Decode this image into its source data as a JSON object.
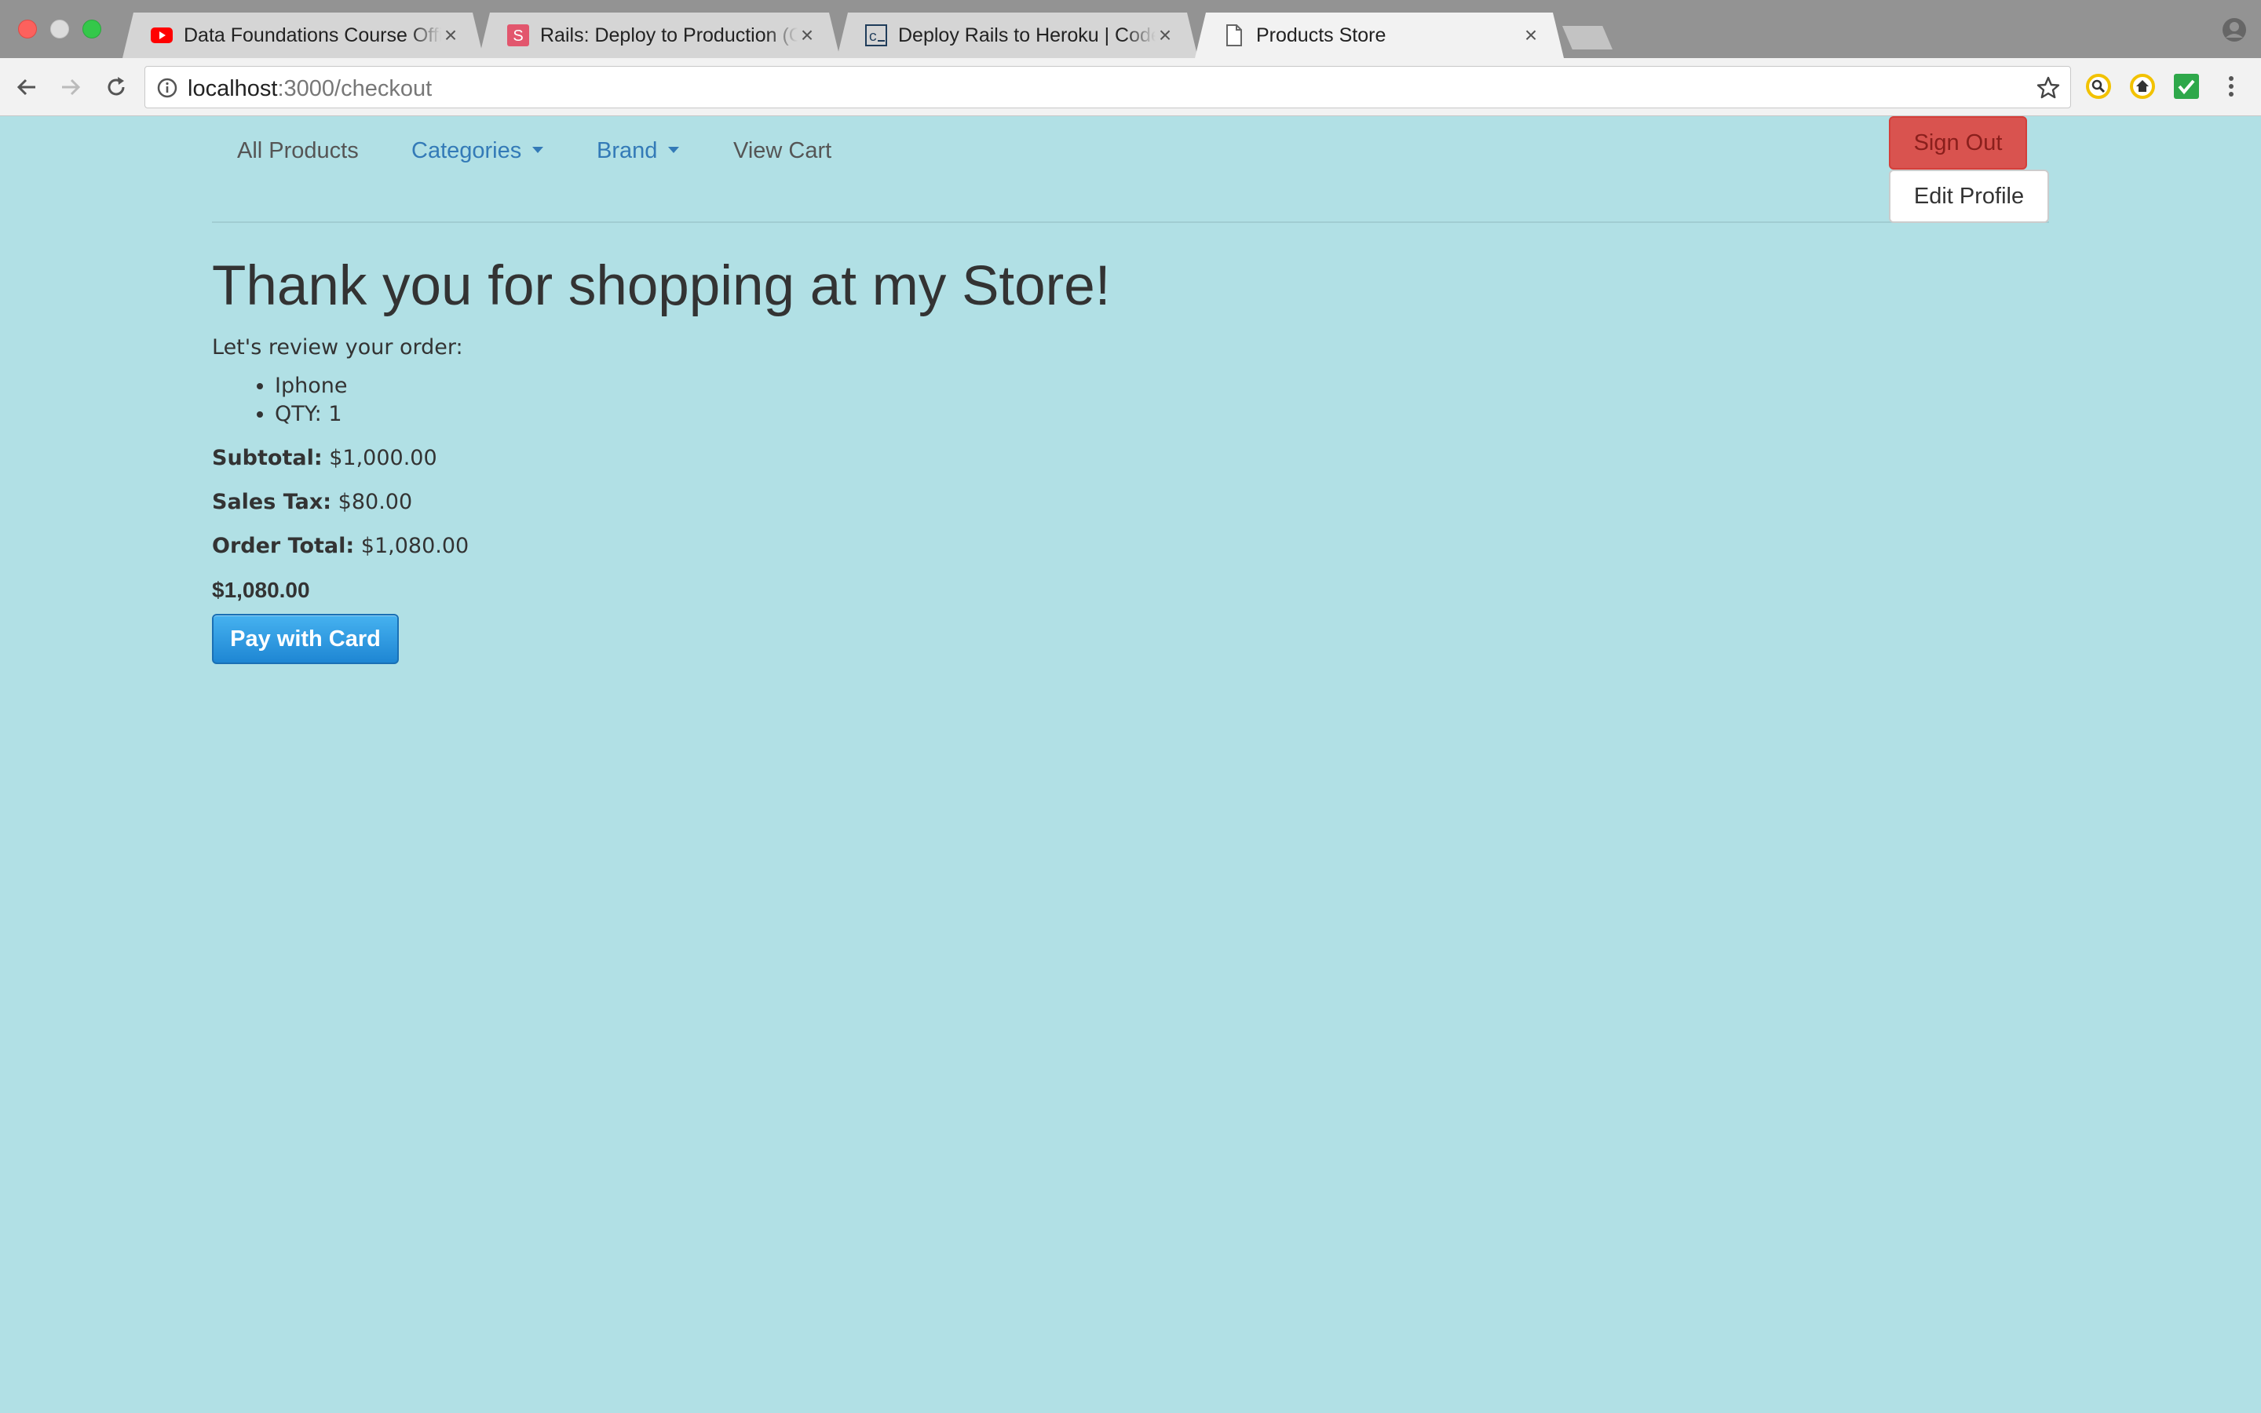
{
  "browser": {
    "tabs": [
      {
        "title": "Data Foundations Course Offic",
        "icon": "youtube-icon"
      },
      {
        "title": "Rails: Deploy to Production (Co",
        "icon": "s-favicon-icon"
      },
      {
        "title": "Deploy Rails to Heroku | Codec",
        "icon": "codecademy-icon"
      },
      {
        "title": "Products Store",
        "icon": "page-icon"
      }
    ],
    "url_host": "localhost",
    "url_rest": ":3000/checkout"
  },
  "nav": {
    "all_products": "All Products",
    "categories": "Categories",
    "brand": "Brand",
    "view_cart": "View Cart",
    "sign_out": "Sign Out",
    "edit_profile": "Edit Profile"
  },
  "checkout": {
    "heading": "Thank you for shopping at my Store!",
    "intro": "Let's review your order:",
    "items": [
      "Iphone",
      "QTY: 1"
    ],
    "subtotal_label": "Subtotal:",
    "subtotal_value": "$1,000.00",
    "tax_label": "Sales Tax:",
    "tax_value": "$80.00",
    "total_label": "Order Total:",
    "total_value": "$1,080.00",
    "charge_amount": "$1,080.00",
    "pay_button": "Pay with Card"
  },
  "colors": {
    "page_background": "#b1e0e5",
    "link_blue": "#337ab7",
    "sign_out_red": "#d9534f",
    "pay_button_blue": "#1e86d3"
  }
}
